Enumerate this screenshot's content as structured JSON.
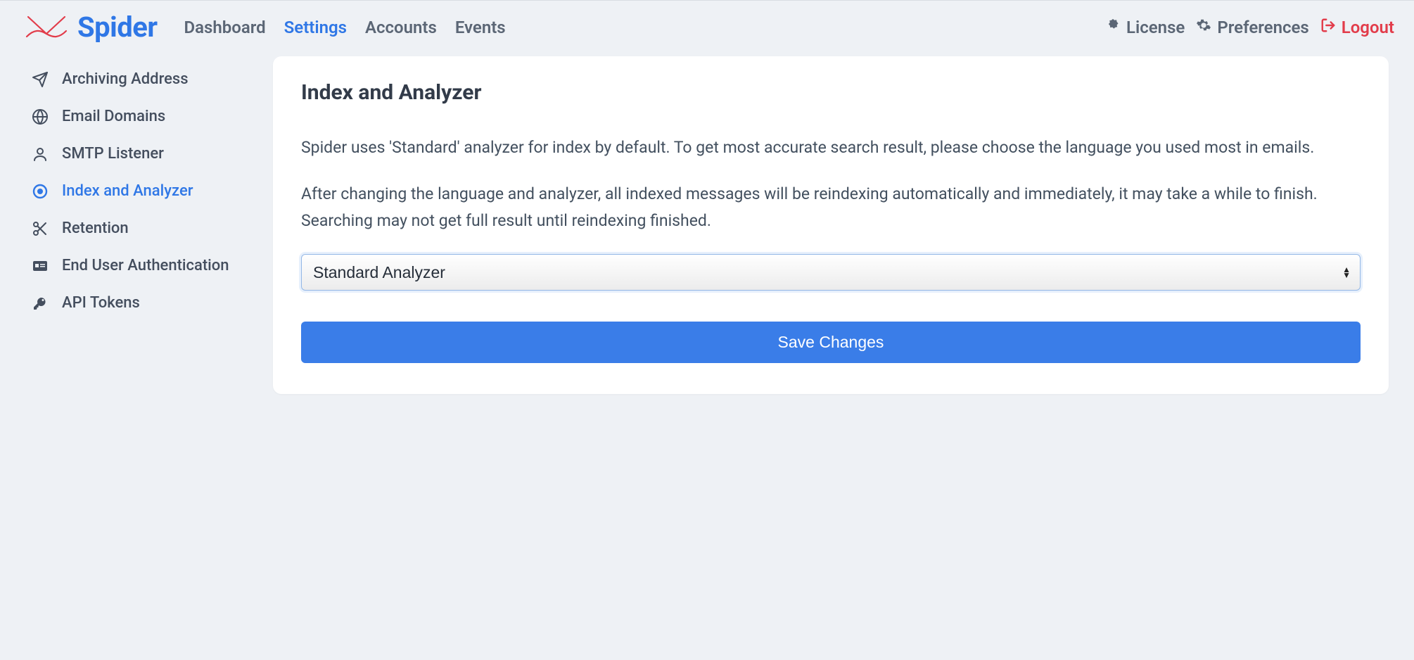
{
  "brand": {
    "name": "Spider"
  },
  "nav": {
    "items": [
      {
        "label": "Dashboard",
        "active": false
      },
      {
        "label": "Settings",
        "active": true
      },
      {
        "label": "Accounts",
        "active": false
      },
      {
        "label": "Events",
        "active": false
      }
    ]
  },
  "topright": {
    "license": "License",
    "preferences": "Preferences",
    "logout": "Logout"
  },
  "sidebar": {
    "items": [
      {
        "label": "Archiving Address"
      },
      {
        "label": "Email Domains"
      },
      {
        "label": "SMTP Listener"
      },
      {
        "label": "Index and Analyzer"
      },
      {
        "label": "Retention"
      },
      {
        "label": "End User Authentication"
      },
      {
        "label": "API Tokens"
      }
    ]
  },
  "main": {
    "title": "Index and Analyzer",
    "para1": "Spider uses 'Standard' analyzer for index by default. To get most accurate search result, please choose the language you used most in emails.",
    "para2": "After changing the language and analyzer, all indexed messages will be reindexing automatically and immediately, it may take a while to finish. Searching may not get full result until reindexing finished.",
    "select_value": "Standard Analyzer",
    "save_label": "Save Changes"
  }
}
